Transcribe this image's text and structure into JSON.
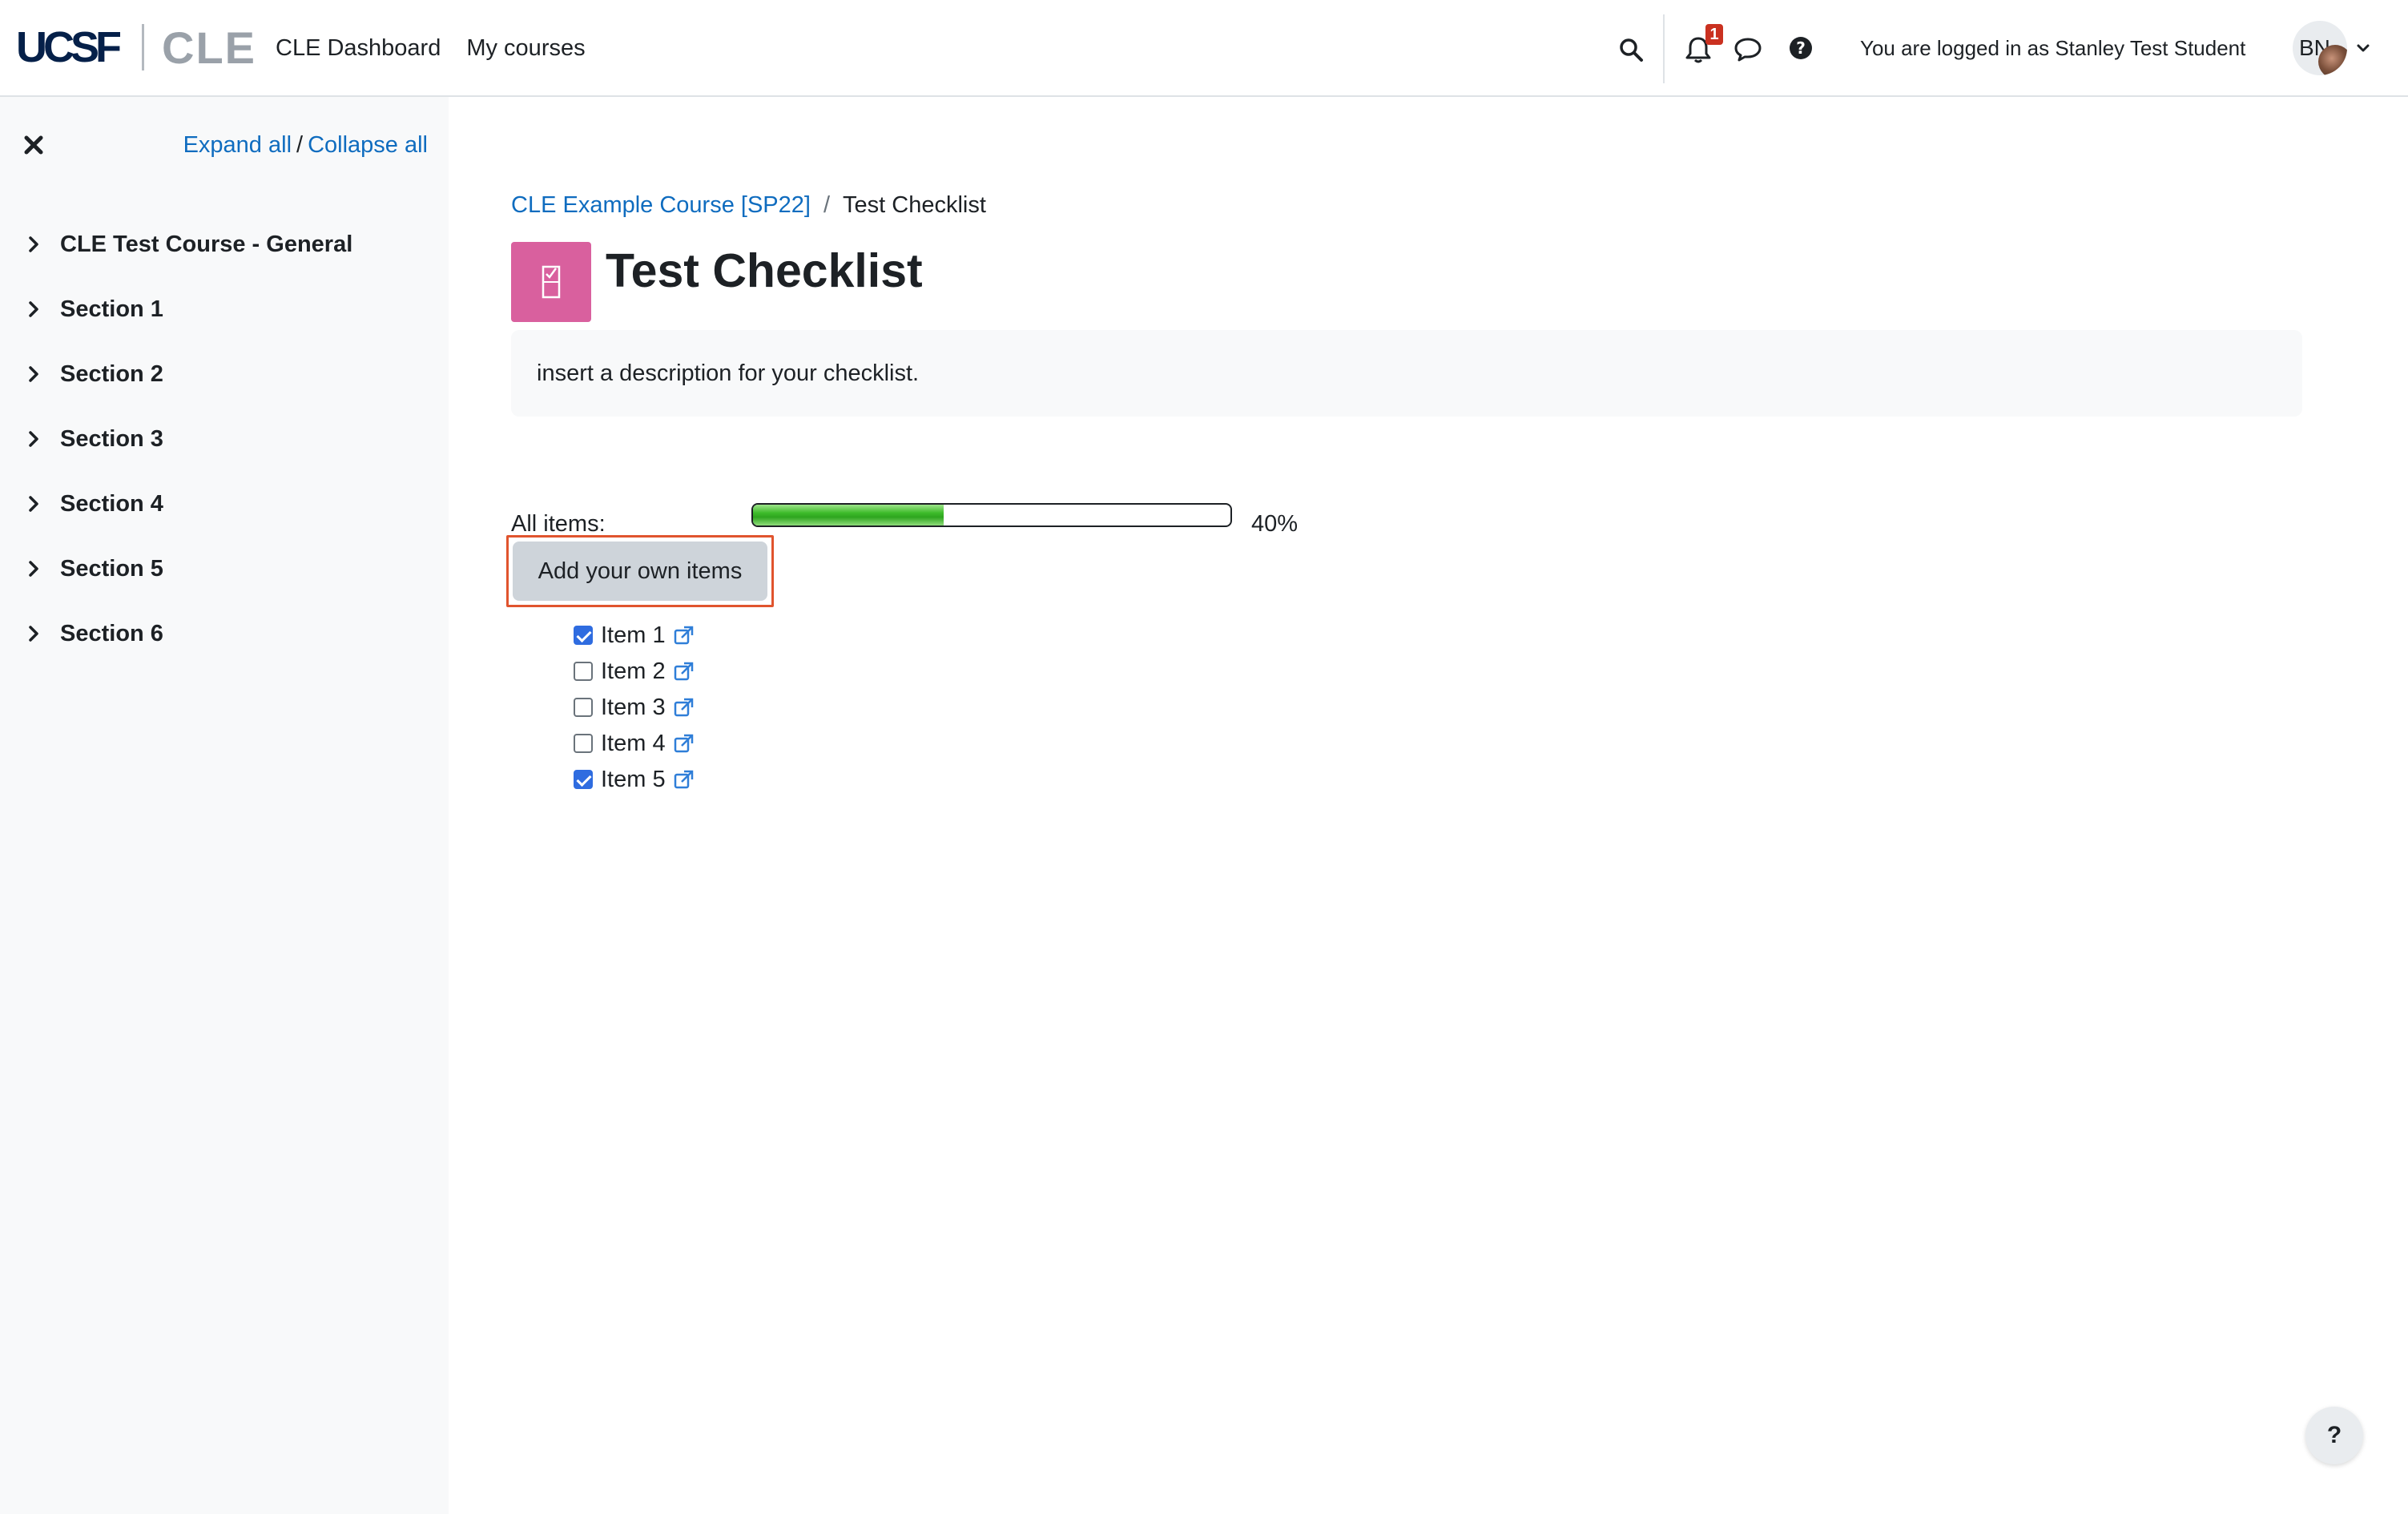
{
  "header": {
    "logo_primary": "UCSF",
    "logo_secondary": "CLE",
    "nav_links": [
      "CLE Dashboard",
      "My courses"
    ],
    "notification_count": "1",
    "login_text": "You are logged in as Stanley Test Student",
    "avatar_initials": "BN",
    "icons": [
      "search-icon",
      "bell-icon",
      "chat-bubble-icon",
      "question-circle-icon",
      "chevron-down-icon"
    ]
  },
  "sidebar": {
    "expand_all": "Expand all",
    "separator": "/",
    "collapse_all": "Collapse all",
    "sections": [
      {
        "label": "CLE Test Course - General"
      },
      {
        "label": "Section 1"
      },
      {
        "label": "Section 2"
      },
      {
        "label": "Section 3"
      },
      {
        "label": "Section 4"
      },
      {
        "label": "Section 5"
      },
      {
        "label": "Section 6"
      }
    ]
  },
  "main": {
    "breadcrumb": {
      "course": "CLE Example Course [SP22]",
      "separator": "/",
      "current": "Test Checklist"
    },
    "title": "Test Checklist",
    "description": "insert a description for your checklist.",
    "progress": {
      "label": "All items:",
      "percent_text": "40%",
      "value": 0.4
    },
    "add_button_label": "Add your own items",
    "items": [
      {
        "label": "Item 1",
        "checked": true
      },
      {
        "label": "Item 2",
        "checked": false
      },
      {
        "label": "Item 3",
        "checked": false
      },
      {
        "label": "Item 4",
        "checked": false
      },
      {
        "label": "Item 5",
        "checked": true
      }
    ]
  },
  "help_button_label": "?",
  "colors": {
    "link": "#0f6cbf",
    "activity_icon_bg": "#d9609e",
    "progress_fill": "#3dbb2a",
    "highlight_frame": "#e0542e",
    "checkbox_checked": "#2f6ce0",
    "badge": "#ca3120"
  }
}
